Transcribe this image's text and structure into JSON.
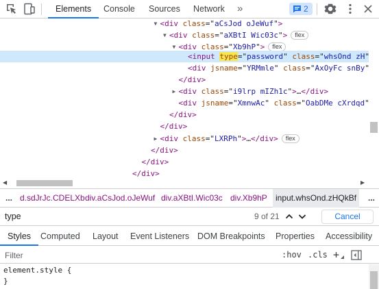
{
  "toolbar": {
    "tabs": [
      "Elements",
      "Console",
      "Sources",
      "Network"
    ],
    "more_label": "»",
    "issues_count": "2",
    "colors": {
      "accent": "#1a73e8",
      "badge_bg": "#d2e3fc"
    }
  },
  "dom_tree": {
    "lines": [
      {
        "indent": 17,
        "expander": "open",
        "tag": "div",
        "attrs": [
          {
            "name": "class",
            "value": "aCsJod oJeWuf"
          }
        ],
        "end": ">",
        "flex": false
      },
      {
        "indent": 18,
        "expander": "open",
        "tag": "div",
        "attrs": [
          {
            "name": "class",
            "value": "aXBtI Wic03c"
          }
        ],
        "end": ">",
        "flex": true
      },
      {
        "indent": 19,
        "expander": "open",
        "tag": "div",
        "attrs": [
          {
            "name": "class",
            "value": "Xb9hP"
          }
        ],
        "end": ">",
        "flex": true
      },
      {
        "indent": 20,
        "expander": "none",
        "tag": "input",
        "attrs": [
          {
            "name": "type",
            "value": "password",
            "highlight": true
          },
          {
            "name": "class",
            "value": "whsOnd zH"
          }
        ],
        "end": "",
        "flex": false,
        "selected": true
      },
      {
        "indent": 20,
        "expander": "none",
        "tag": "div",
        "attrs": [
          {
            "name": "jsname",
            "value": "YRMmle"
          },
          {
            "name": "class",
            "value": "AxOyFc snBy"
          }
        ],
        "end": "",
        "flex": false
      },
      {
        "indent": 19,
        "expander": "none",
        "closing": "div"
      },
      {
        "indent": 19,
        "expander": "closed",
        "tag": "div",
        "attrs": [
          {
            "name": "class",
            "value": "i9lrp mIZh1c"
          }
        ],
        "end": ">…</div>",
        "flex": false
      },
      {
        "indent": 19,
        "expander": "none",
        "tag": "div",
        "attrs": [
          {
            "name": "jsname",
            "value": "XmnwAc"
          },
          {
            "name": "class",
            "value": "OabDMe cXrdqd"
          }
        ],
        "end": "",
        "flex": false
      },
      {
        "indent": 18,
        "expander": "none",
        "closing": "div"
      },
      {
        "indent": 17,
        "expander": "none",
        "closing": "div"
      },
      {
        "indent": 17,
        "expander": "closed",
        "tag": "div",
        "attrs": [
          {
            "name": "class",
            "value": "LXRPh"
          }
        ],
        "end": ">…</div>",
        "flex": true
      },
      {
        "indent": 16,
        "expander": "none",
        "closing": "div"
      },
      {
        "indent": 15,
        "expander": "none",
        "closing": "div"
      },
      {
        "indent": 14,
        "expander": "none",
        "closing": "div"
      }
    ],
    "flex_label": "flex"
  },
  "breadcrumbs": {
    "dots": "...",
    "items": [
      "d.sdJrJc.CDELXb",
      "div.aCsJod.oJeWuf",
      "div.aXBtI.Wic03c",
      "div.Xb9hP",
      "input.whsOnd.zHQkBf"
    ],
    "selected_index": 4
  },
  "search": {
    "value": "type",
    "match_text": "9 of 21",
    "cancel_label": "Cancel"
  },
  "sidebar_tabs": [
    "Styles",
    "Computed",
    "Layout",
    "Event Listeners",
    "DOM Breakpoints",
    "Properties",
    "Accessibility"
  ],
  "filter": {
    "placeholder": "Filter",
    "hov_label": ":hov",
    "cls_label": ".cls",
    "plus_label": "+"
  },
  "styles": {
    "line1": "element.style {",
    "line2": "}"
  }
}
